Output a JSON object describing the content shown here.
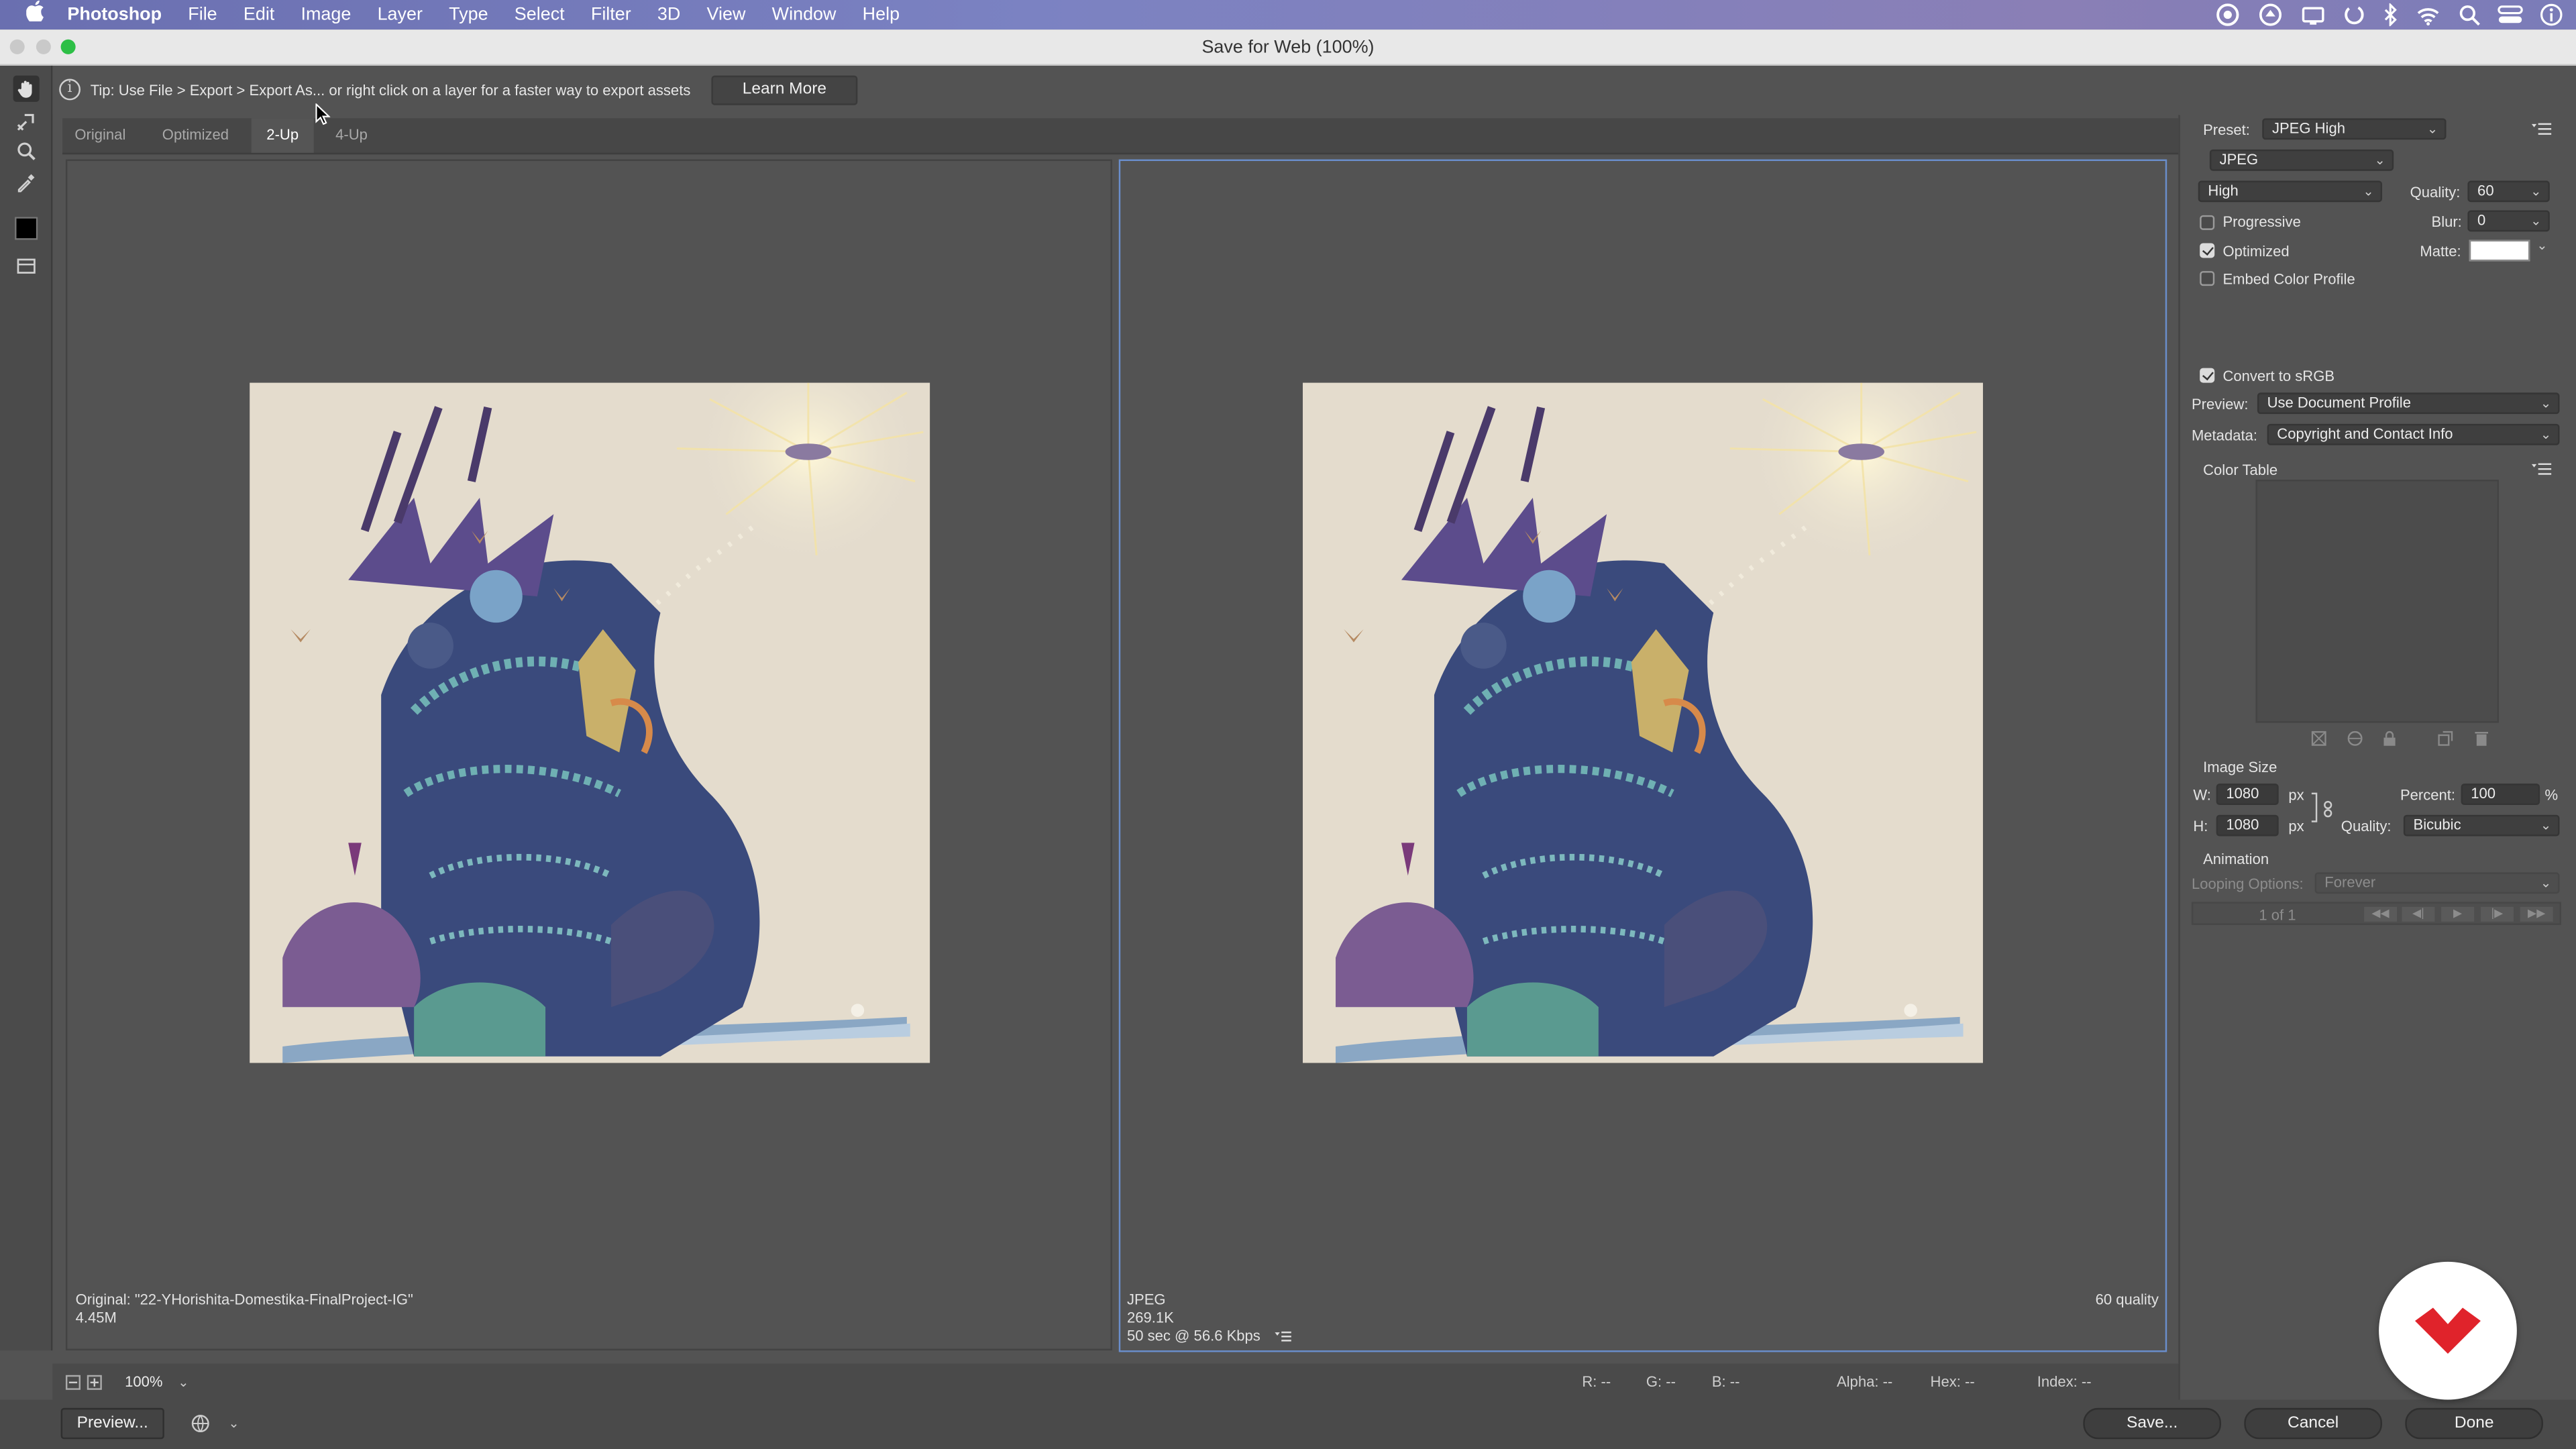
{
  "menubar": {
    "app_name": "Photoshop",
    "items": [
      "File",
      "Edit",
      "Image",
      "Layer",
      "Type",
      "Select",
      "Filter",
      "3D",
      "View",
      "Window",
      "Help"
    ],
    "tray_icons": [
      "creative-cloud-icon",
      "spark-icon",
      "display-icon",
      "sync-icon",
      "bluetooth-icon",
      "wifi-icon",
      "spotlight-search-icon",
      "control-center-icon",
      "info-icon"
    ]
  },
  "window": {
    "title": "Save for Web (100%)"
  },
  "tools": [
    "hand-tool-icon",
    "slice-select-tool-icon",
    "zoom-tool-icon",
    "eyedropper-tool-icon",
    "eyedropper-color-swatch-icon",
    "toggle-slices-icon"
  ],
  "tip": {
    "text": "Tip: Use File > Export > Export As...  or right click on a layer for a faster way to export assets",
    "learn_more": "Learn More"
  },
  "tabs": [
    {
      "label": "Original",
      "active": false
    },
    {
      "label": "Optimized",
      "active": false
    },
    {
      "label": "2-Up",
      "active": true
    },
    {
      "label": "4-Up",
      "active": false
    }
  ],
  "left_pane": {
    "caption_line1": "Original: \"22-YHorishita-Domestika-FinalProject-IG\"",
    "caption_line2": "4.45M"
  },
  "right_pane": {
    "format": "JPEG",
    "size": "269.1K",
    "download": "50 sec @ 56.6 Kbps",
    "quality_note": "60 quality"
  },
  "status": {
    "zoom": "100%",
    "r": "R: --",
    "g": "G: --",
    "b": "B: --",
    "alpha": "Alpha: --",
    "hex": "Hex: --",
    "index": "Index: --"
  },
  "footer": {
    "preview_label": "Preview...",
    "save_label": "Save...",
    "cancel_label": "Cancel",
    "done_label": "Done"
  },
  "settings": {
    "preset_label": "Preset:",
    "preset_value": "JPEG High",
    "format_value": "JPEG",
    "compression_value": "High",
    "quality_label": "Quality:",
    "quality_value": "60",
    "progressive_label": "Progressive",
    "progressive_checked": false,
    "blur_label": "Blur:",
    "blur_value": "0",
    "optimized_label": "Optimized",
    "optimized_checked": true,
    "matte_label": "Matte:",
    "matte_color": "#ffffff",
    "embed_label": "Embed Color Profile",
    "embed_checked": false,
    "convert_label": "Convert to sRGB",
    "convert_checked": true,
    "preview_label": "Preview:",
    "preview_value": "Use Document Profile",
    "metadata_label": "Metadata:",
    "metadata_value": "Copyright and Contact Info",
    "color_table_label": "Color Table"
  },
  "image_size": {
    "heading": "Image Size",
    "w_label": "W:",
    "w_value": "1080",
    "h_label": "H:",
    "h_value": "1080",
    "unit": "px",
    "percent_label": "Percent:",
    "percent_value": "100",
    "percent_unit": "%",
    "quality_label": "Quality:",
    "quality_value": "Bicubic"
  },
  "animation": {
    "heading": "Animation",
    "looping_label": "Looping Options:",
    "looping_value": "Forever",
    "frame_counter": "1 of 1"
  },
  "colors": {
    "accent": "#6a8ecc",
    "logo": "#e0232b"
  }
}
